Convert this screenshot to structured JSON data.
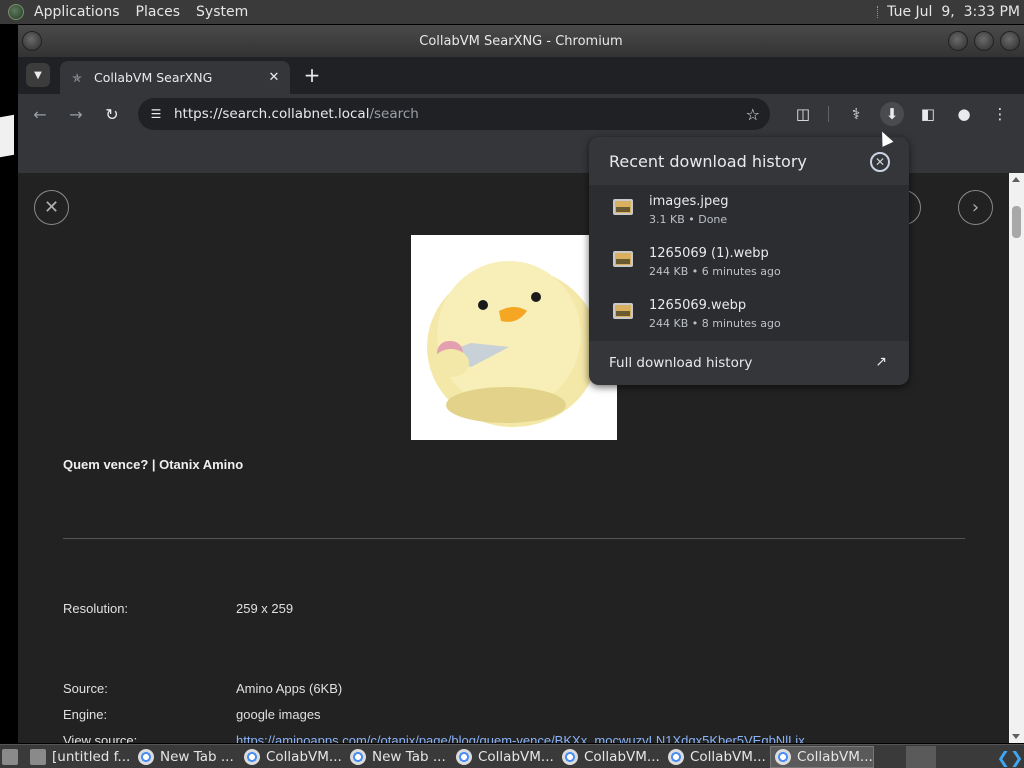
{
  "top_panel": {
    "menus": [
      "Applications",
      "Places",
      "System"
    ],
    "clock": "Tue Jul  9,  3:33 PM"
  },
  "window": {
    "title": "CollabVM SearXNG - Chromium"
  },
  "tabs": [
    {
      "label": "CollabVM SearXNG",
      "active": true
    }
  ],
  "toolbar": {
    "url_host": "https://search.collabnet.local",
    "url_path": "/search"
  },
  "content": {
    "image_description": "yellow chick holding a knife",
    "result_title": "Quem vence? | Otanix Amino",
    "meta": [
      {
        "label": "Resolution:",
        "value": "259 x 259"
      },
      {
        "label": "Source:",
        "value": "Amino Apps (6KB)"
      },
      {
        "label": "Engine:",
        "value": "google images"
      },
      {
        "label": "View source:",
        "value": "https://aminoapps.com/c/otanix/page/blog/quem-vence/BKXx_mocwuzvLN1Xdgx5Kber5VEqbNlLjx"
      }
    ]
  },
  "downloads": {
    "title": "Recent download history",
    "items": [
      {
        "name": "images.jpeg",
        "meta": "3.1 KB • Done"
      },
      {
        "name": "1265069 (1).webp",
        "meta": "244 KB • 6 minutes ago"
      },
      {
        "name": "1265069.webp",
        "meta": "244 KB • 8 minutes ago"
      }
    ],
    "footer": "Full download history"
  },
  "taskbar": {
    "items": [
      {
        "label": "[untitled f...",
        "icon": "folder-icon"
      },
      {
        "label": "New Tab ...",
        "icon": "chromium-icon"
      },
      {
        "label": "CollabVM...",
        "icon": "chromium-icon"
      },
      {
        "label": "New Tab ...",
        "icon": "chromium-icon"
      },
      {
        "label": "CollabVM...",
        "icon": "chromium-icon"
      },
      {
        "label": "CollabVM...",
        "icon": "chromium-icon"
      },
      {
        "label": "CollabVM...",
        "icon": "chromium-icon"
      },
      {
        "label": "CollabVM...",
        "icon": "chromium-icon",
        "active": true
      }
    ]
  },
  "colors": {
    "link": "#8ab4f8",
    "page_bg": "#222222",
    "toolbar_bg": "#35363a"
  }
}
